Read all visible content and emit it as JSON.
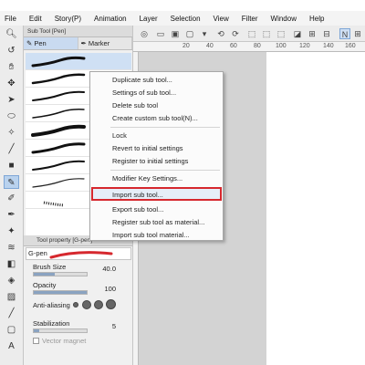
{
  "menubar": {
    "items": [
      "File",
      "Edit",
      "Story(P)",
      "Animation",
      "Layer",
      "Selection",
      "View",
      "Filter",
      "Window",
      "Help"
    ]
  },
  "ruler": {
    "ticks": [
      "20",
      "40",
      "60",
      "80",
      "100",
      "120",
      "140",
      "160"
    ]
  },
  "subtool": {
    "header": "Sub Tool [Pen]",
    "tabs": [
      "Pen",
      "Marker"
    ],
    "brush_count": 9
  },
  "context_menu": {
    "items": [
      "Duplicate sub tool...",
      "Settings of sub tool...",
      "Delete sub tool",
      "Create custom sub tool(N)...",
      "Lock",
      "Revert to initial settings",
      "Register to initial settings",
      "Modifier Key Settings...",
      "Import sub tool...",
      "Export sub tool...",
      "Register sub tool as material...",
      "Import sub tool material..."
    ],
    "highlighted": "Import sub tool...",
    "highlight_color": "#d6282e"
  },
  "properties": {
    "header": "Tool property [G-pen]",
    "brush_name": "G-pen",
    "brush_size_label": "Brush Size",
    "brush_size_value": "40.0",
    "opacity_label": "Opacity",
    "opacity_value": "100",
    "antialiasing_label": "Anti-aliasing",
    "stabilization_label": "Stabilization",
    "stabilization_value": "5",
    "vector_magnet_label": "Vector magnet"
  },
  "colors": {
    "accent": "#b9d2ee",
    "selected_row": "#cfe0f4",
    "canvas_bg": "#d3d3d3"
  }
}
